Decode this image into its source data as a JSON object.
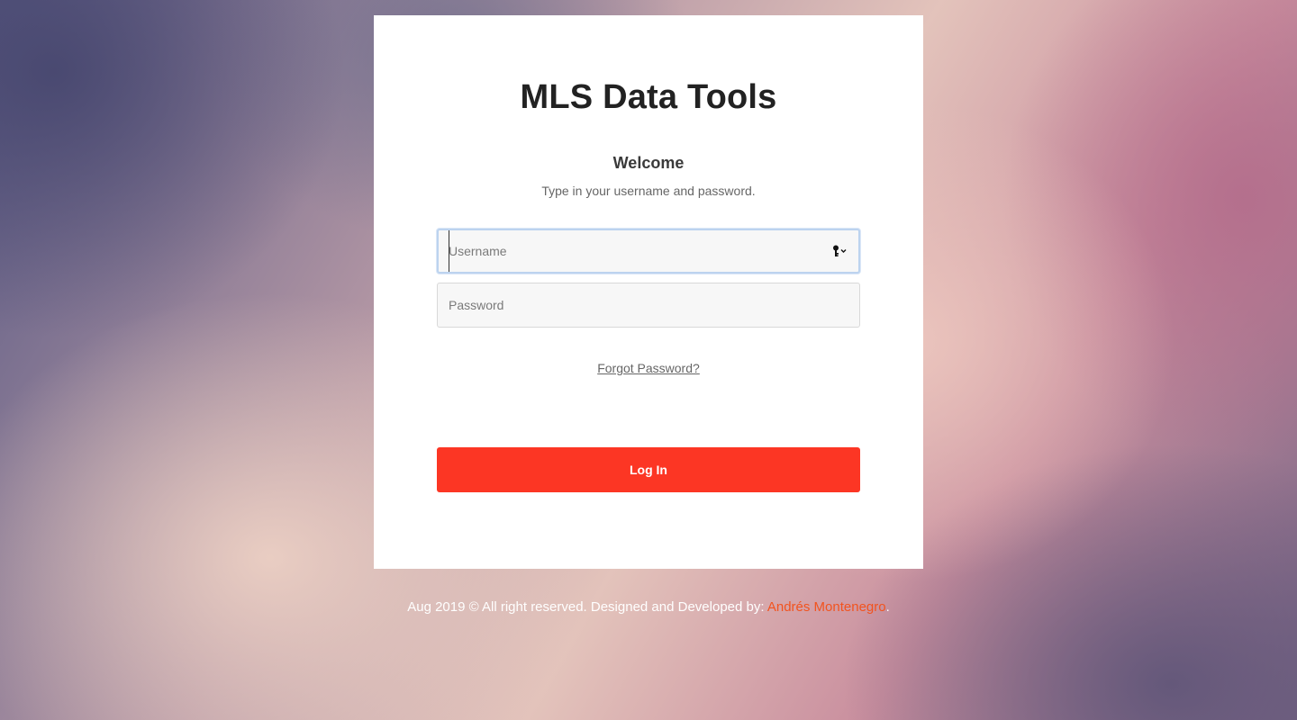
{
  "card": {
    "title": "MLS Data Tools",
    "welcome": "Welcome",
    "subtitle": "Type in your username and password."
  },
  "form": {
    "username_placeholder": "Username",
    "password_placeholder": "Password",
    "forgot_label": "Forgot Password?",
    "login_label": "Log In",
    "username_icon": "key-icon"
  },
  "footer": {
    "prefix": "Aug 2019 © All right reserved. Designed and Developed by: ",
    "author": "Andrés Montenegro",
    "suffix": "."
  },
  "colors": {
    "accent": "#fc3624",
    "author_link": "#f2531e"
  }
}
